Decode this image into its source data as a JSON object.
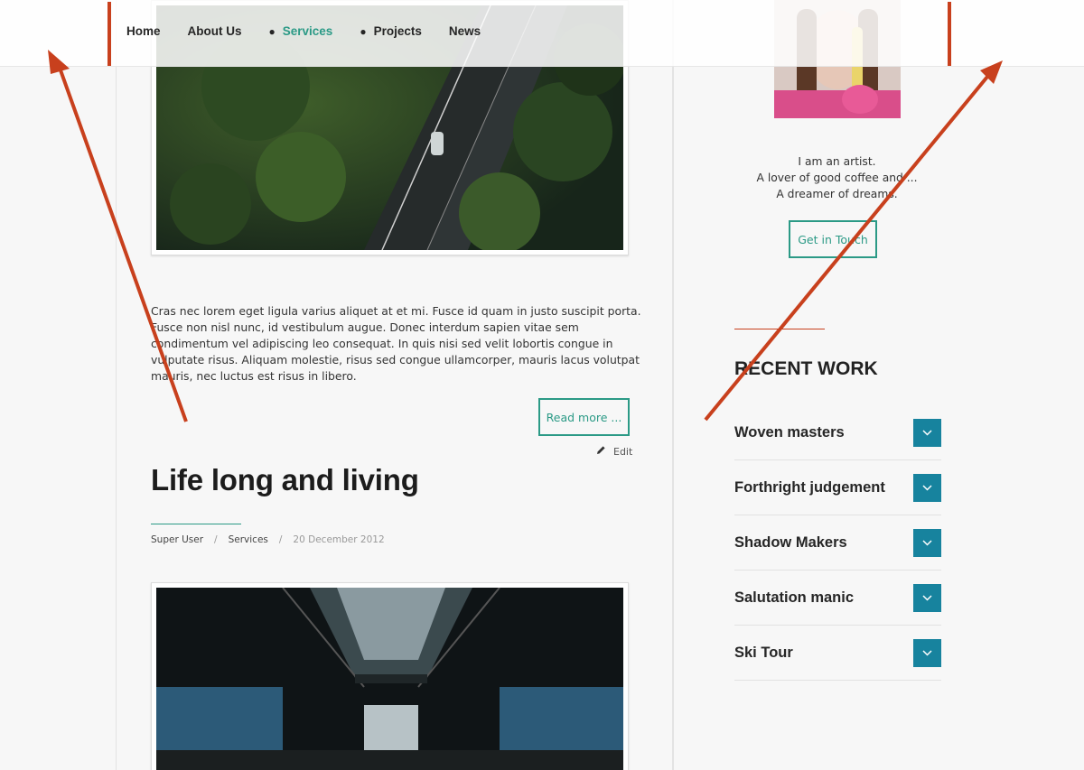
{
  "header": {
    "nav": [
      {
        "label": "Home",
        "bullet": false,
        "active": false
      },
      {
        "label": "About Us",
        "bullet": false,
        "active": false
      },
      {
        "label": "Services",
        "bullet": true,
        "active": true
      },
      {
        "label": "Projects",
        "bullet": true,
        "active": false
      },
      {
        "label": "News",
        "bullet": false,
        "active": false
      }
    ]
  },
  "article1": {
    "body": "Cras nec lorem eget ligula varius aliquet at et mi. Fusce id quam in justo suscipit porta. Fusce non nisl nunc, id vestibulum augue. Donec interdum sapien vitae sem condimentum vel adipiscing leo consequat. In quis nisi sed velit lobortis congue in vulputate risus. Aliquam molestie, risus sed congue ullamcorper, mauris lacus volutpat mauris, nec luctus est risus in libero.",
    "read_more": "Read more ...",
    "edit": "Edit"
  },
  "article2": {
    "title": "Life long and living",
    "author": "Super User",
    "category": "Services",
    "date": "20 December 2012"
  },
  "sidebar": {
    "bio": [
      "I am an artist.",
      "A lover of good coffee and ...",
      "A dreamer of dreams."
    ],
    "contact_button": "Get in Touch",
    "recent_title": "RECENT WORK",
    "recent": [
      "Woven masters",
      "Forthright judgement",
      "Shadow Makers",
      "Salutation manic",
      "Ski Tour"
    ]
  },
  "colors": {
    "accent_teal": "#2b9a86",
    "accent_red": "#c8401d",
    "toggle_blue": "#17839e"
  }
}
